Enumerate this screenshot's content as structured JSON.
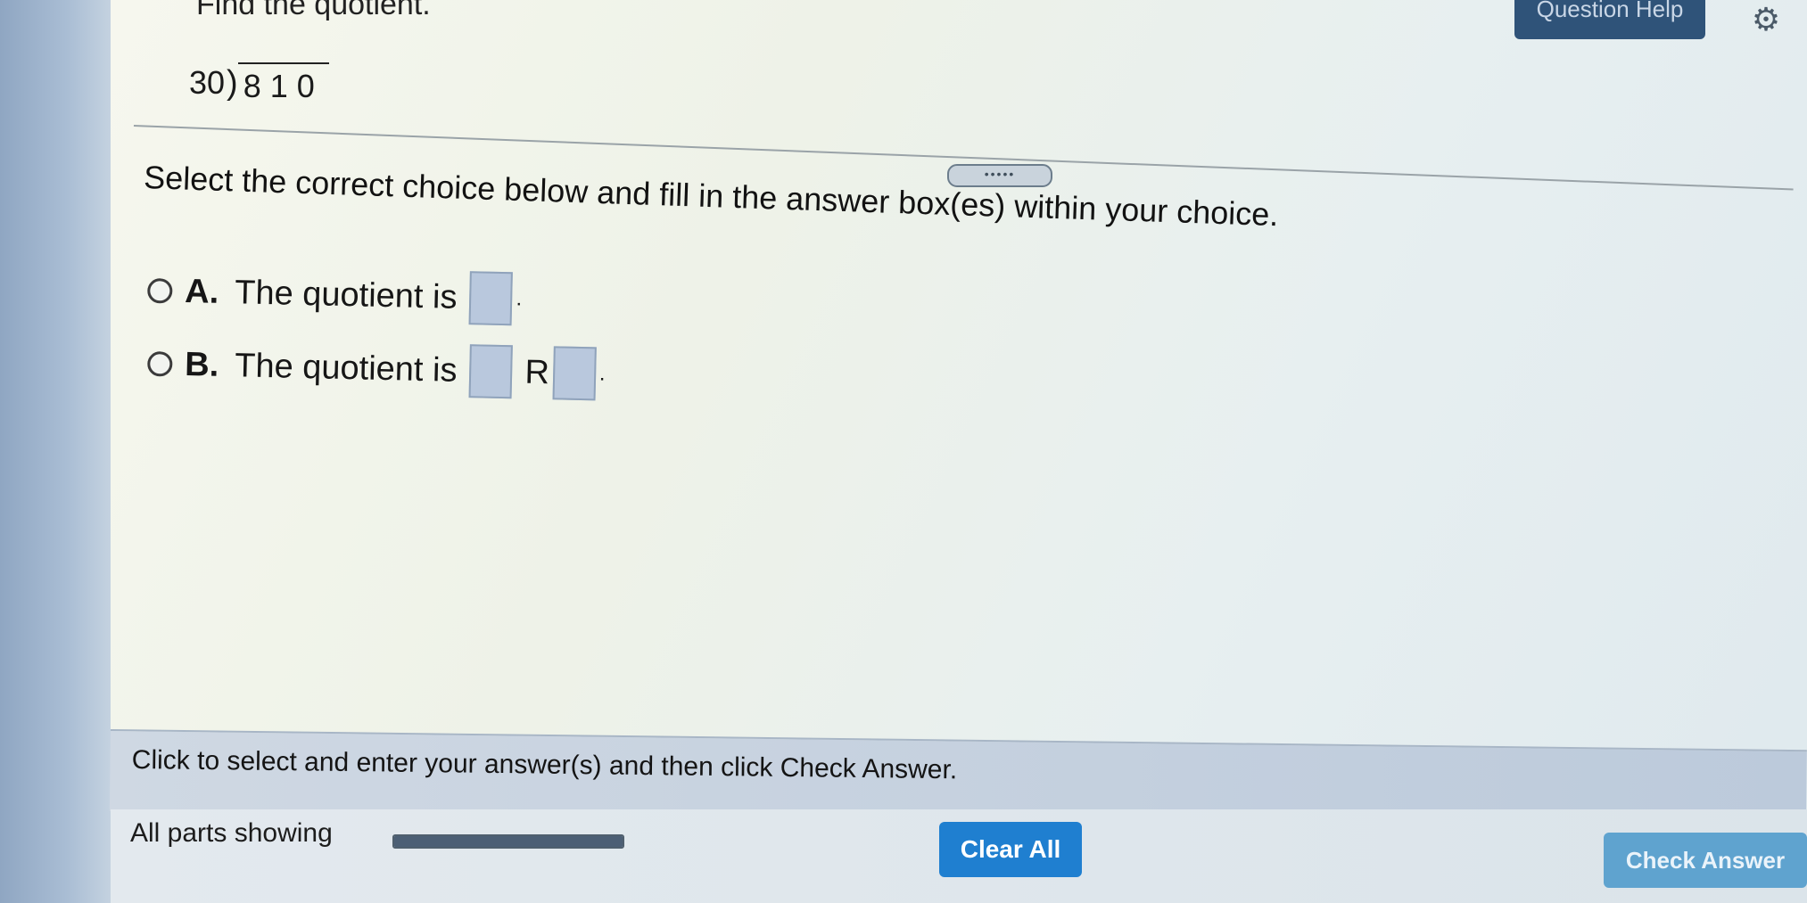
{
  "header": {
    "title_partial": "Find the quotient.",
    "help_label": "Question Help"
  },
  "problem": {
    "divisor": "30",
    "dividend": "810"
  },
  "instruction": "Select the correct choice below and fill in the answer box(es) within your choice.",
  "choices": [
    {
      "letter": "A.",
      "text": "The quotient is"
    },
    {
      "letter": "B.",
      "text": "The quotient is",
      "remainder_label": "R"
    }
  ],
  "footer": {
    "hint": "Click to select and enter your answer(s) and then click Check Answer.",
    "parts_label": "All parts showing",
    "progress_fraction": 1.0,
    "clear_label": "Clear All",
    "check_label": "Check Answer"
  },
  "icons": {
    "settings": "gear-icon",
    "expand": "ellipsis-handle"
  }
}
